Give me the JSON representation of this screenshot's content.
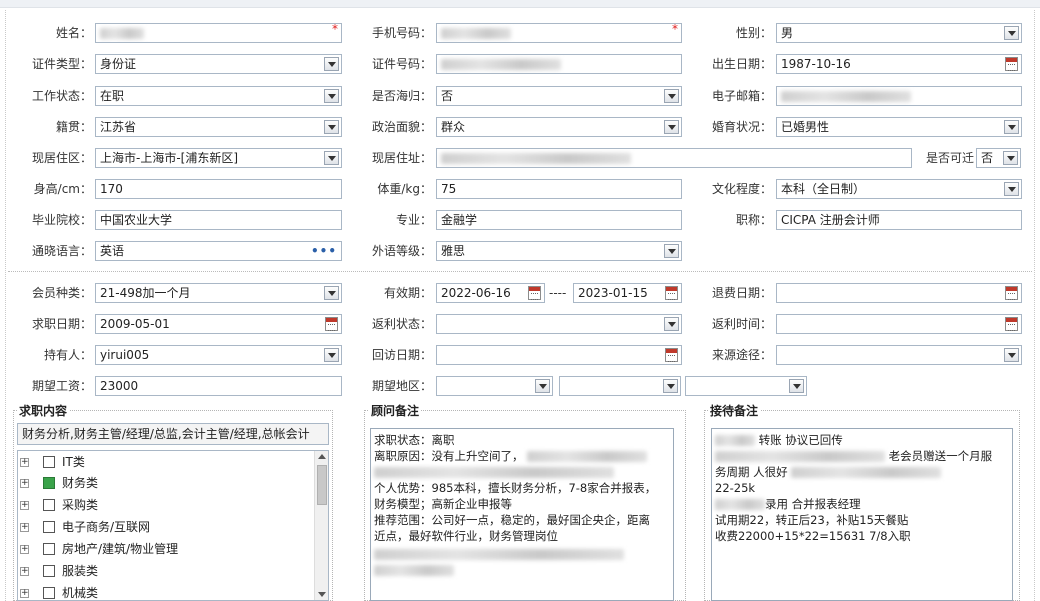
{
  "form": {
    "name": {
      "label": "姓名：",
      "value": ""
    },
    "phone": {
      "label": "手机号码：",
      "value": ""
    },
    "gender": {
      "label": "性别：",
      "value": "男"
    },
    "id_type": {
      "label": "证件类型：",
      "value": "身份证"
    },
    "id_number": {
      "label": "证件号码：",
      "value": ""
    },
    "birth_date": {
      "label": "出生日期：",
      "value": "1987-10-16"
    },
    "work_status": {
      "label": "工作状态：",
      "value": "在职"
    },
    "returnee": {
      "label": "是否海归：",
      "value": "否"
    },
    "email": {
      "label": "电子邮箱：",
      "value": ""
    },
    "native_place": {
      "label": "籍贯：",
      "value": "江苏省"
    },
    "political": {
      "label": "政治面貌：",
      "value": "群众"
    },
    "marital": {
      "label": "婚育状况：",
      "value": "已婚男性"
    },
    "residence_area": {
      "label": "现居住区：",
      "value": "上海市-上海市-[浦东新区]"
    },
    "address": {
      "label": "现居住址：",
      "value": ""
    },
    "relocate": {
      "label": "是否可迁",
      "value": "否"
    },
    "height": {
      "label": "身高/cm：",
      "value": "170"
    },
    "weight": {
      "label": "体重/kg：",
      "value": "75"
    },
    "education": {
      "label": "文化程度：",
      "value": "本科（全日制）"
    },
    "school": {
      "label": "毕业院校：",
      "value": "中国农业大学"
    },
    "major": {
      "label": "专业：",
      "value": "金融学"
    },
    "title": {
      "label": "职称：",
      "value": "CICPA 注册会计师"
    },
    "language": {
      "label": "通晓语言：",
      "value": "英语"
    },
    "foreign_level": {
      "label": "外语等级：",
      "value": "雅思"
    }
  },
  "member": {
    "member_type": {
      "label": "会员种类：",
      "value": "21-498加一个月"
    },
    "validity": {
      "label": "有效期：",
      "start": "2022-06-16",
      "separator": "----",
      "end": "2023-01-15"
    },
    "refund_date": {
      "label": "退费日期：",
      "value": ""
    },
    "job_date": {
      "label": "求职日期：",
      "value": "2009-05-01"
    },
    "rebate_status": {
      "label": "返利状态：",
      "value": ""
    },
    "rebate_time": {
      "label": "返利时间：",
      "value": ""
    },
    "holder": {
      "label": "持有人：",
      "value": "yirui005"
    },
    "visit_date": {
      "label": "回访日期：",
      "value": ""
    },
    "source": {
      "label": "来源途径：",
      "value": ""
    },
    "expected_salary": {
      "label": "期望工资：",
      "value": "23000"
    },
    "expected_region": {
      "label": "期望地区：",
      "values": [
        "",
        "",
        ""
      ]
    }
  },
  "job_content": {
    "title": "求职内容",
    "summary": "财务分析,财务主管/经理/总监,会计主管/经理,总帐会计",
    "categories": [
      {
        "label": "IT类",
        "checked": false
      },
      {
        "label": "财务类",
        "checked": true
      },
      {
        "label": "采购类",
        "checked": false
      },
      {
        "label": "电子商务/互联网",
        "checked": false
      },
      {
        "label": "房地产/建筑/物业管理",
        "checked": false
      },
      {
        "label": "服装类",
        "checked": false
      },
      {
        "label": "机械类",
        "checked": false
      }
    ]
  },
  "consultant_notes": {
    "title": "顾问备注",
    "lines": [
      "求职状态：离职",
      "离职原因：没有上升空间了，",
      "",
      "个人优势：985本科，擅长财务分析，7-8家合并报表，",
      "财务模型；高新企业申报等",
      "推荐范围：公司好一点，稳定的，最好国企央企，距离",
      "近点，最好软件行业，财务管理岗位"
    ]
  },
  "reception_notes": {
    "title": "接待备注",
    "lines": [
      "转账 协议已回传",
      "老会员赠送一个月服",
      "务周期  人很好",
      "22-25k",
      "",
      "",
      "录用 合并报表经理",
      "试用期22，转正后23，补贴15天餐贴",
      "收费22000+15*22=15631  7/8入职"
    ]
  }
}
